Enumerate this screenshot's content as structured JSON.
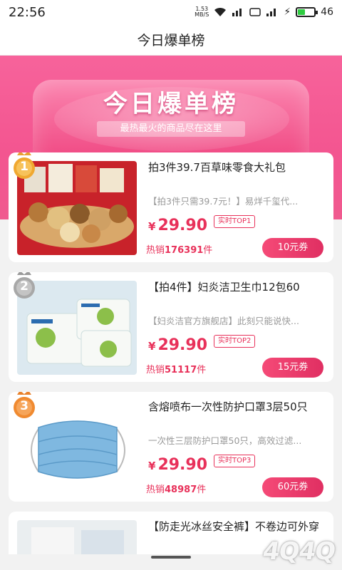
{
  "status": {
    "time": "22:56",
    "speed_top": "1.53",
    "speed_unit": "MB/S",
    "battery": "46"
  },
  "title": "今日爆单榜",
  "banner": {
    "title": "今日爆单榜",
    "subtitle": "最热最火的商品尽在这里"
  },
  "products": [
    {
      "rank": "1",
      "title": "拍3件39.7百草味零食大礼包",
      "desc": "【拍3件只需39.7元！】易烊千玺代...",
      "price": "29.90",
      "top": "实时TOP1",
      "sold_prefix": "热销",
      "sold_count": "176391",
      "sold_suffix": "件",
      "coupon": "10元券",
      "rank_color": "#f0a830"
    },
    {
      "rank": "2",
      "title": "【拍4件】妇炎洁卫生巾12包60",
      "desc": "【妇炎洁官方旗舰店】此刻只能说快...",
      "price": "29.90",
      "top": "实时TOP2",
      "sold_prefix": "热销",
      "sold_count": "51117",
      "sold_suffix": "件",
      "coupon": "15元券",
      "rank_color": "#a8a8a8"
    },
    {
      "rank": "3",
      "title": "含熔喷布一次性防护口罩3层50只",
      "desc": "一次性三层防护口罩50只，高效过滤...",
      "price": "29.90",
      "top": "实时TOP3",
      "sold_prefix": "热销",
      "sold_count": "48987",
      "sold_suffix": "件",
      "coupon": "60元券",
      "rank_color": "#f08a30"
    },
    {
      "title": "【防走光冰丝安全裤】不卷边可外穿"
    }
  ],
  "currency": "¥",
  "watermark": "4Q4Q"
}
